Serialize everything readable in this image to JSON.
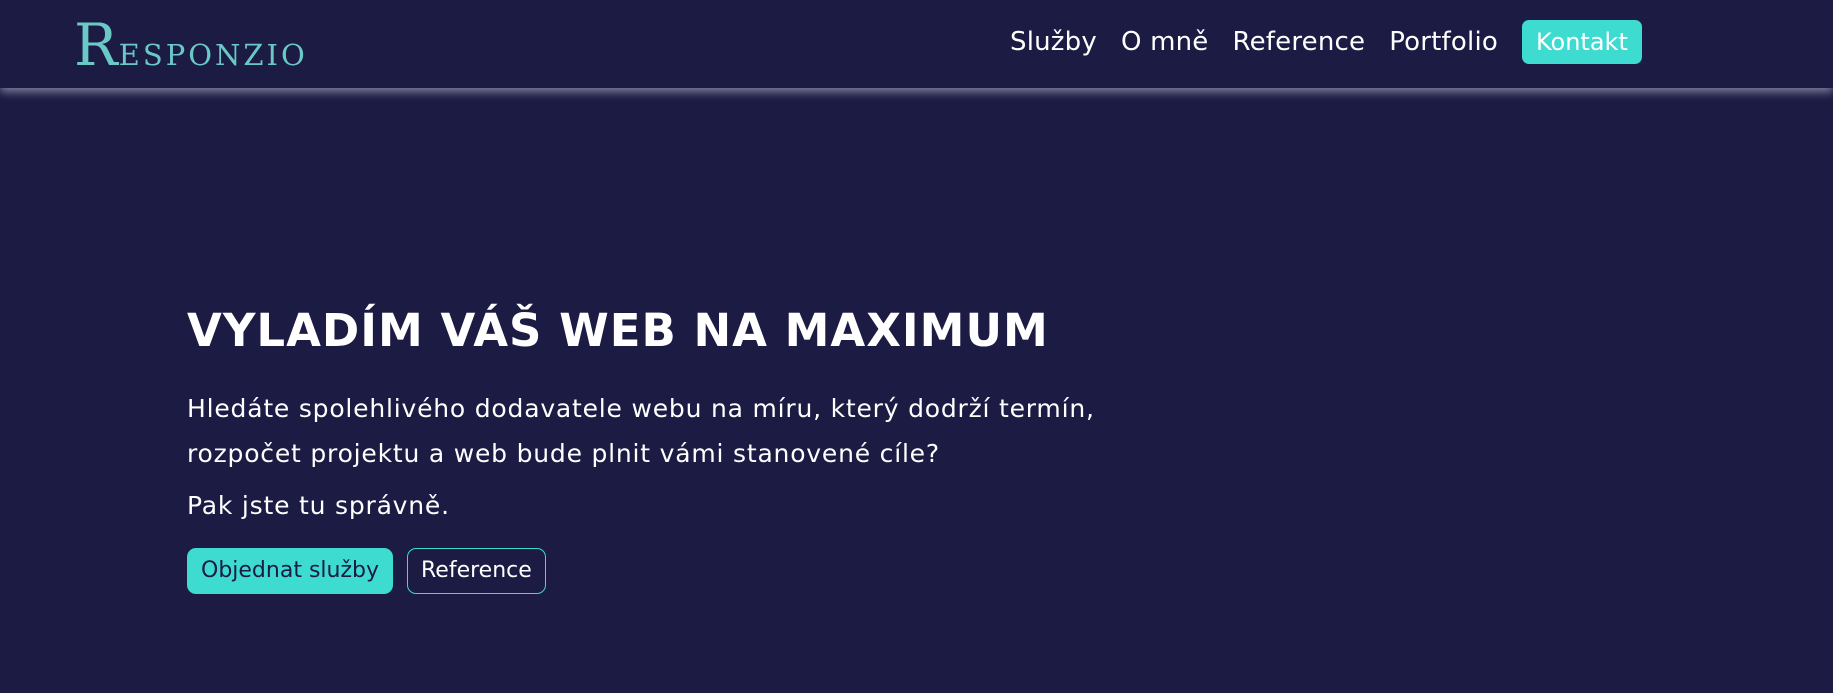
{
  "brand": {
    "logo_first": "R",
    "logo_rest": "ESPONZIO",
    "accent": "#3ddbd0",
    "logo_color": "#6ac9c6",
    "background": "#1b1b43"
  },
  "nav": {
    "items": [
      "Služby",
      "O mně",
      "Reference",
      "Portfolio"
    ],
    "contact": "Kontakt"
  },
  "hero": {
    "title": "VYLADÍM VÁŠ WEB NA MAXIMUM",
    "lead": "Hledáte spolehlivého dodavatele webu na míru, který dodrží termín, rozpočet projektu a web bude plnit vámi stanovené cíle?",
    "note": "Pak jste tu správně.",
    "primary_button": "Objednat služby",
    "secondary_button": "Reference"
  }
}
